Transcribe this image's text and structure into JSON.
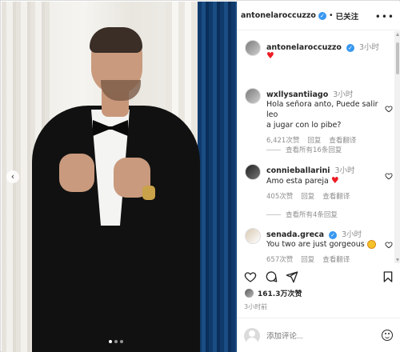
{
  "header": {
    "username": "antonelaroccuzzo",
    "separator": "•",
    "follow_label": "已关注",
    "more_label": "•••"
  },
  "caption": {
    "username": "antonelaroccuzzo",
    "time": "3小时",
    "text": "♥"
  },
  "comments": [
    {
      "username": "wxllysantiiago",
      "time": "3小时",
      "text_line1": "Hola señora anto, Puede salir leo",
      "text_line2": "a jugar con lo pibe?",
      "likes": "6,421次赞",
      "reply": "回复",
      "translate": "查看翻译",
      "replies_label": "查看所有16条回复"
    },
    {
      "username": "connieballarini",
      "time": "3小时",
      "text": "Amo esta pareja",
      "emoji": "heart",
      "likes": "405次赞",
      "reply": "回复",
      "translate": "查看翻译",
      "replies_label": "查看所有4条回复"
    },
    {
      "username": "senada.greca",
      "time": "3小时",
      "text": "You two are just gorgeous",
      "emoji": "heart-eyes",
      "likes": "657次赞",
      "reply": "回复",
      "translate": "查看翻译"
    }
  ],
  "post": {
    "likes_text": "161.3万次赞",
    "time_ago": "3小时前"
  },
  "add_comment": {
    "placeholder": "添加评论..."
  },
  "carousel": {
    "count": 3,
    "active_index": 0
  },
  "colors": {
    "verified": "#3897f0",
    "heart": "#ed1c24",
    "muted": "#8e8e8e"
  }
}
